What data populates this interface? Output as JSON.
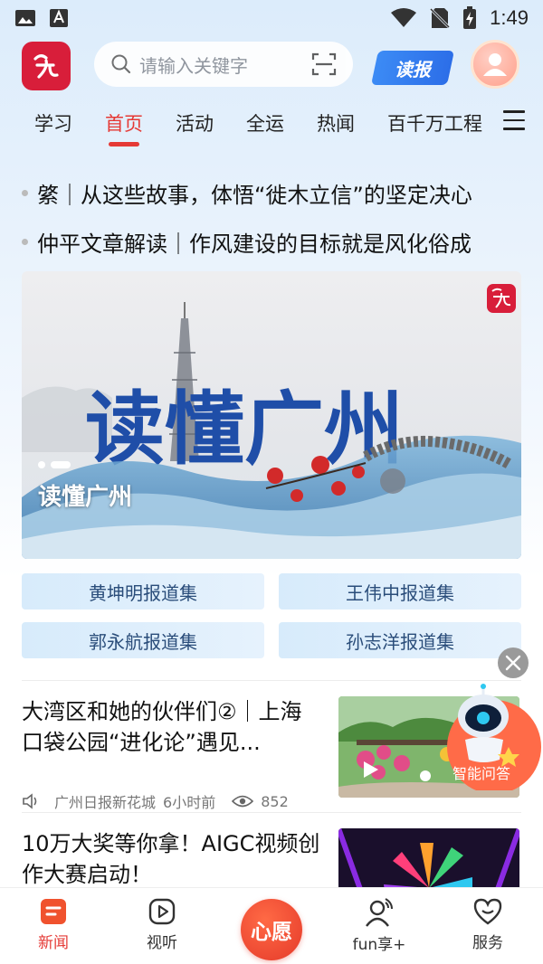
{
  "status_bar": {
    "time": "1:49"
  },
  "header": {
    "search_placeholder": "请输入关键字",
    "read_button": "读报"
  },
  "tabs": [
    {
      "label": "学习",
      "active": false
    },
    {
      "label": "首页",
      "active": true
    },
    {
      "label": "活动",
      "active": false
    },
    {
      "label": "全运",
      "active": false
    },
    {
      "label": "热闻",
      "active": false
    },
    {
      "label": "百千万工程",
      "active": false
    }
  ],
  "headlines": [
    "綮｜从这些故事，体悟“徙木立信”的坚定决心",
    "仲平文章解读｜作风建设的目标就是风化俗成"
  ],
  "banner": {
    "caption": "读懂广州",
    "art_title": "读懂广州",
    "slide_count": 2,
    "active_slide": 2
  },
  "collections": [
    "黄坤明报道集",
    "王伟中报道集",
    "郭永航报道集",
    "孙志洋报道集"
  ],
  "news": [
    {
      "title": "大湾区和她的伙伴们②｜上海口袋公园“进化论”遇见...",
      "source": "广州日报新花城",
      "time": "6小时前",
      "views": "852",
      "has_video": true
    },
    {
      "title": "10万大奖等你拿！AIGC视频创作大赛启动！",
      "has_video": false
    }
  ],
  "ai_helper": {
    "label": "智能问答"
  },
  "bottom_nav": [
    {
      "label": "新闻",
      "icon": "news-icon",
      "active": true
    },
    {
      "label": "视听",
      "icon": "play-icon",
      "active": false
    },
    {
      "label": "心愿",
      "icon": "wish-button",
      "active": false
    },
    {
      "label": "fun享+",
      "icon": "fun-share-icon",
      "active": false
    },
    {
      "label": "服务",
      "icon": "heart-icon",
      "active": false
    }
  ],
  "colors": {
    "accent": "#e53935",
    "brand_red": "#d81e3a",
    "read_blue": "#2c6ee8",
    "banner_title_blue": "#1f4ea8"
  }
}
